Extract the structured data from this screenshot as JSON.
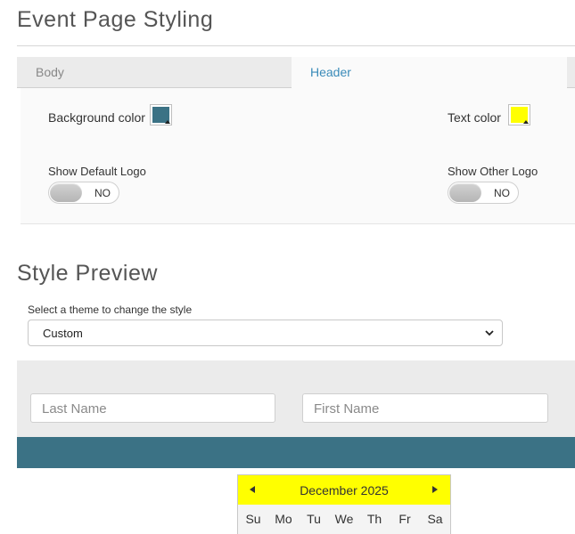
{
  "page": {
    "title": "Event Page Styling"
  },
  "tabs": [
    {
      "label": "Body",
      "active": false
    },
    {
      "label": "Header",
      "active": true
    }
  ],
  "header_settings": {
    "background_color": {
      "label": "Background color",
      "value": "#3b7285"
    },
    "text_color": {
      "label": "Text color",
      "value": "#ffff00"
    },
    "show_default_logo": {
      "label": "Show Default Logo",
      "state": "NO"
    },
    "show_other_logo": {
      "label": "Show Other Logo",
      "state": "NO"
    }
  },
  "style_preview": {
    "title": "Style Preview",
    "theme_label": "Select a theme to change the style",
    "theme_selected": "Custom",
    "last_name_placeholder": "Last Name",
    "first_name_placeholder": "First Name",
    "band_color": "#3b7285"
  },
  "calendar": {
    "month_label": "December 2025",
    "weekdays": [
      "Su",
      "Mo",
      "Tu",
      "We",
      "Th",
      "Fr",
      "Sa"
    ],
    "header_color": "#ffff00"
  },
  "icons": {
    "prev": "triangle-left-icon",
    "next": "triangle-right-icon",
    "select": "chevron-down-icon",
    "swatch": "color-swatch-icon"
  }
}
